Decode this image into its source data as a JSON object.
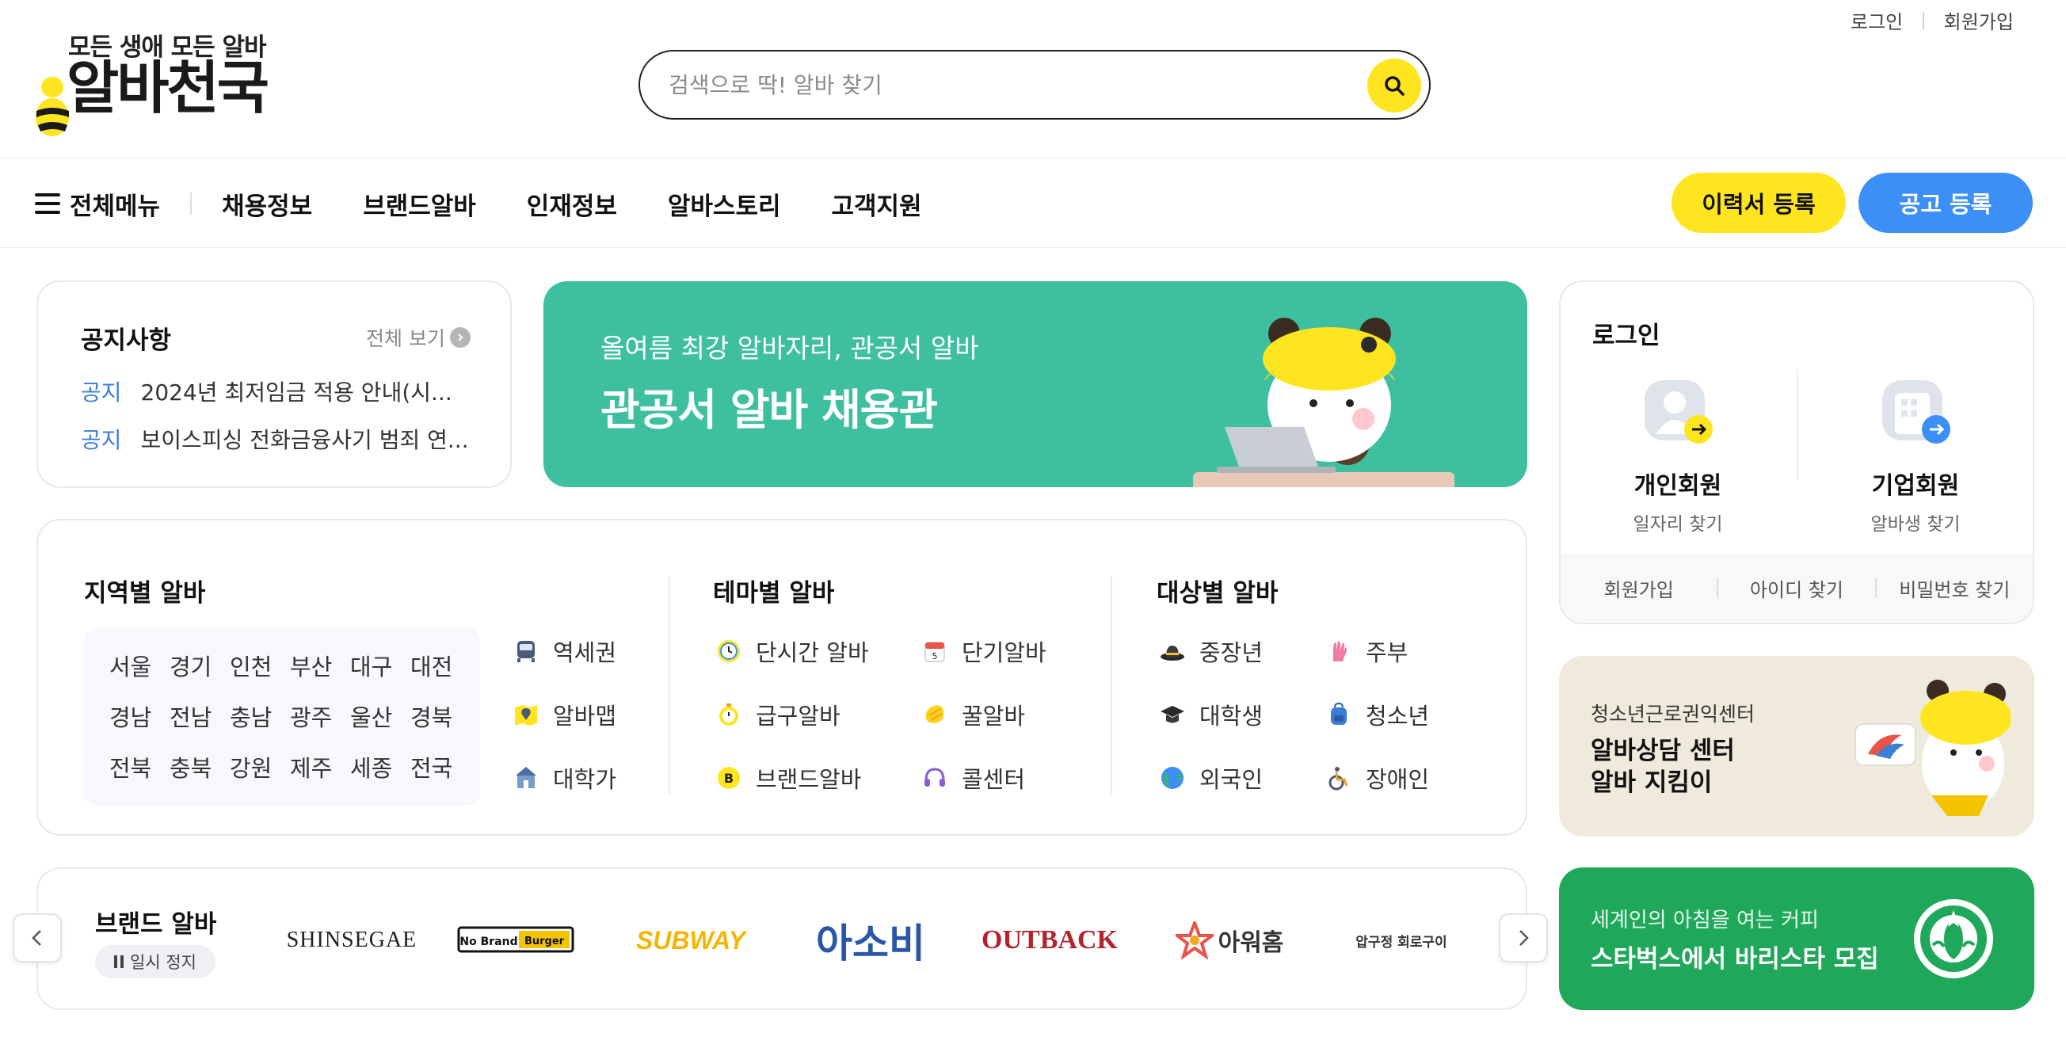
{
  "header": {
    "logo_tagline": "모든 생애 모든 알바",
    "logo_name": "알바천국",
    "top_links": {
      "login": "로그인",
      "signup": "회원가입"
    },
    "search": {
      "placeholder": "검색으로 딱! 알바 찾기"
    }
  },
  "nav": {
    "all_menu": "전체메뉴",
    "items": [
      "채용정보",
      "브랜드알바",
      "인재정보",
      "알바스토리",
      "고객지원"
    ],
    "resume_button": "이력서 등록",
    "post_button": "공고 등록"
  },
  "notice": {
    "title": "공지사항",
    "view_all": "전체 보기",
    "items": [
      {
        "tag": "공지",
        "text": "2024년 최저임금 적용 안내(시..."
      },
      {
        "tag": "공지",
        "text": "보이스피싱 전화금융사기 범죄 연..."
      }
    ]
  },
  "main_banner": {
    "subtitle": "올여름 최강 알바자리, 관공서 알바",
    "title": "관공서 알바 채용관"
  },
  "login_box": {
    "title": "로그인",
    "personal": {
      "name": "개인회원",
      "desc": "일자리 찾기"
    },
    "business": {
      "name": "기업회원",
      "desc": "알바생 찾기"
    },
    "links": [
      "회원가입",
      "아이디 찾기",
      "비밀번호 찾기"
    ]
  },
  "categories": {
    "region": {
      "title": "지역별 알바",
      "rows": [
        [
          "서울",
          "경기",
          "인천",
          "부산",
          "대구",
          "대전"
        ],
        [
          "경남",
          "전남",
          "충남",
          "광주",
          "울산",
          "경북"
        ],
        [
          "전북",
          "충북",
          "강원",
          "제주",
          "세종",
          "전국"
        ]
      ],
      "extra": [
        {
          "icon": "subway-icon",
          "label": "역세권"
        },
        {
          "icon": "map-pin-icon",
          "label": "알바맵"
        },
        {
          "icon": "university-icon",
          "label": "대학가"
        }
      ]
    },
    "theme": {
      "title": "테마별 알바",
      "items": [
        {
          "icon": "clock-icon",
          "label": "단시간 알바"
        },
        {
          "icon": "calendar-icon",
          "label": "단기알바"
        },
        {
          "icon": "stopwatch-icon",
          "label": "급구알바"
        },
        {
          "icon": "honey-icon",
          "label": "꿀알바"
        },
        {
          "icon": "brand-b-icon",
          "label": "브랜드알바"
        },
        {
          "icon": "headset-icon",
          "label": "콜센터"
        }
      ]
    },
    "target": {
      "title": "대상별 알바",
      "items": [
        {
          "icon": "hat-icon",
          "label": "중장년"
        },
        {
          "icon": "glove-icon",
          "label": "주부"
        },
        {
          "icon": "graduation-cap-icon",
          "label": "대학생"
        },
        {
          "icon": "backpack-icon",
          "label": "청소년"
        },
        {
          "icon": "globe-icon",
          "label": "외국인"
        },
        {
          "icon": "wheelchair-icon",
          "label": "장애인"
        }
      ]
    }
  },
  "brands": {
    "title": "브랜드 알바",
    "pause_label": "일시 정지",
    "logos": [
      {
        "name": "SHINSEGAE",
        "color": "#222222"
      },
      {
        "name": "No Brand Burger",
        "color": "#f5c400"
      },
      {
        "name": "SUBWAY",
        "color": "#f2b705"
      },
      {
        "name": "아소비",
        "color": "#2a56a8"
      },
      {
        "name": "OUTBACK",
        "color": "#b3232a"
      },
      {
        "name": "아워홈",
        "color": "#333333"
      },
      {
        "name": "압구정 회로구이",
        "color": "#333333"
      }
    ]
  },
  "ad_youth": {
    "subtitle": "청소년근로권익센터",
    "line1": "알바상담 센터",
    "line2": "알바 지킴이"
  },
  "ad_starbucks": {
    "subtitle": "세계인의 아침을 여는 커피",
    "title": "스타벅스에서 바리스타 모집"
  },
  "colors": {
    "brand_yellow": "#ffe51f",
    "accent_blue": "#3b8ff6",
    "banner_green": "#3ec0a0",
    "starbucks_green": "#1fa85a",
    "notice_tag_blue": "#3b7fd6"
  }
}
